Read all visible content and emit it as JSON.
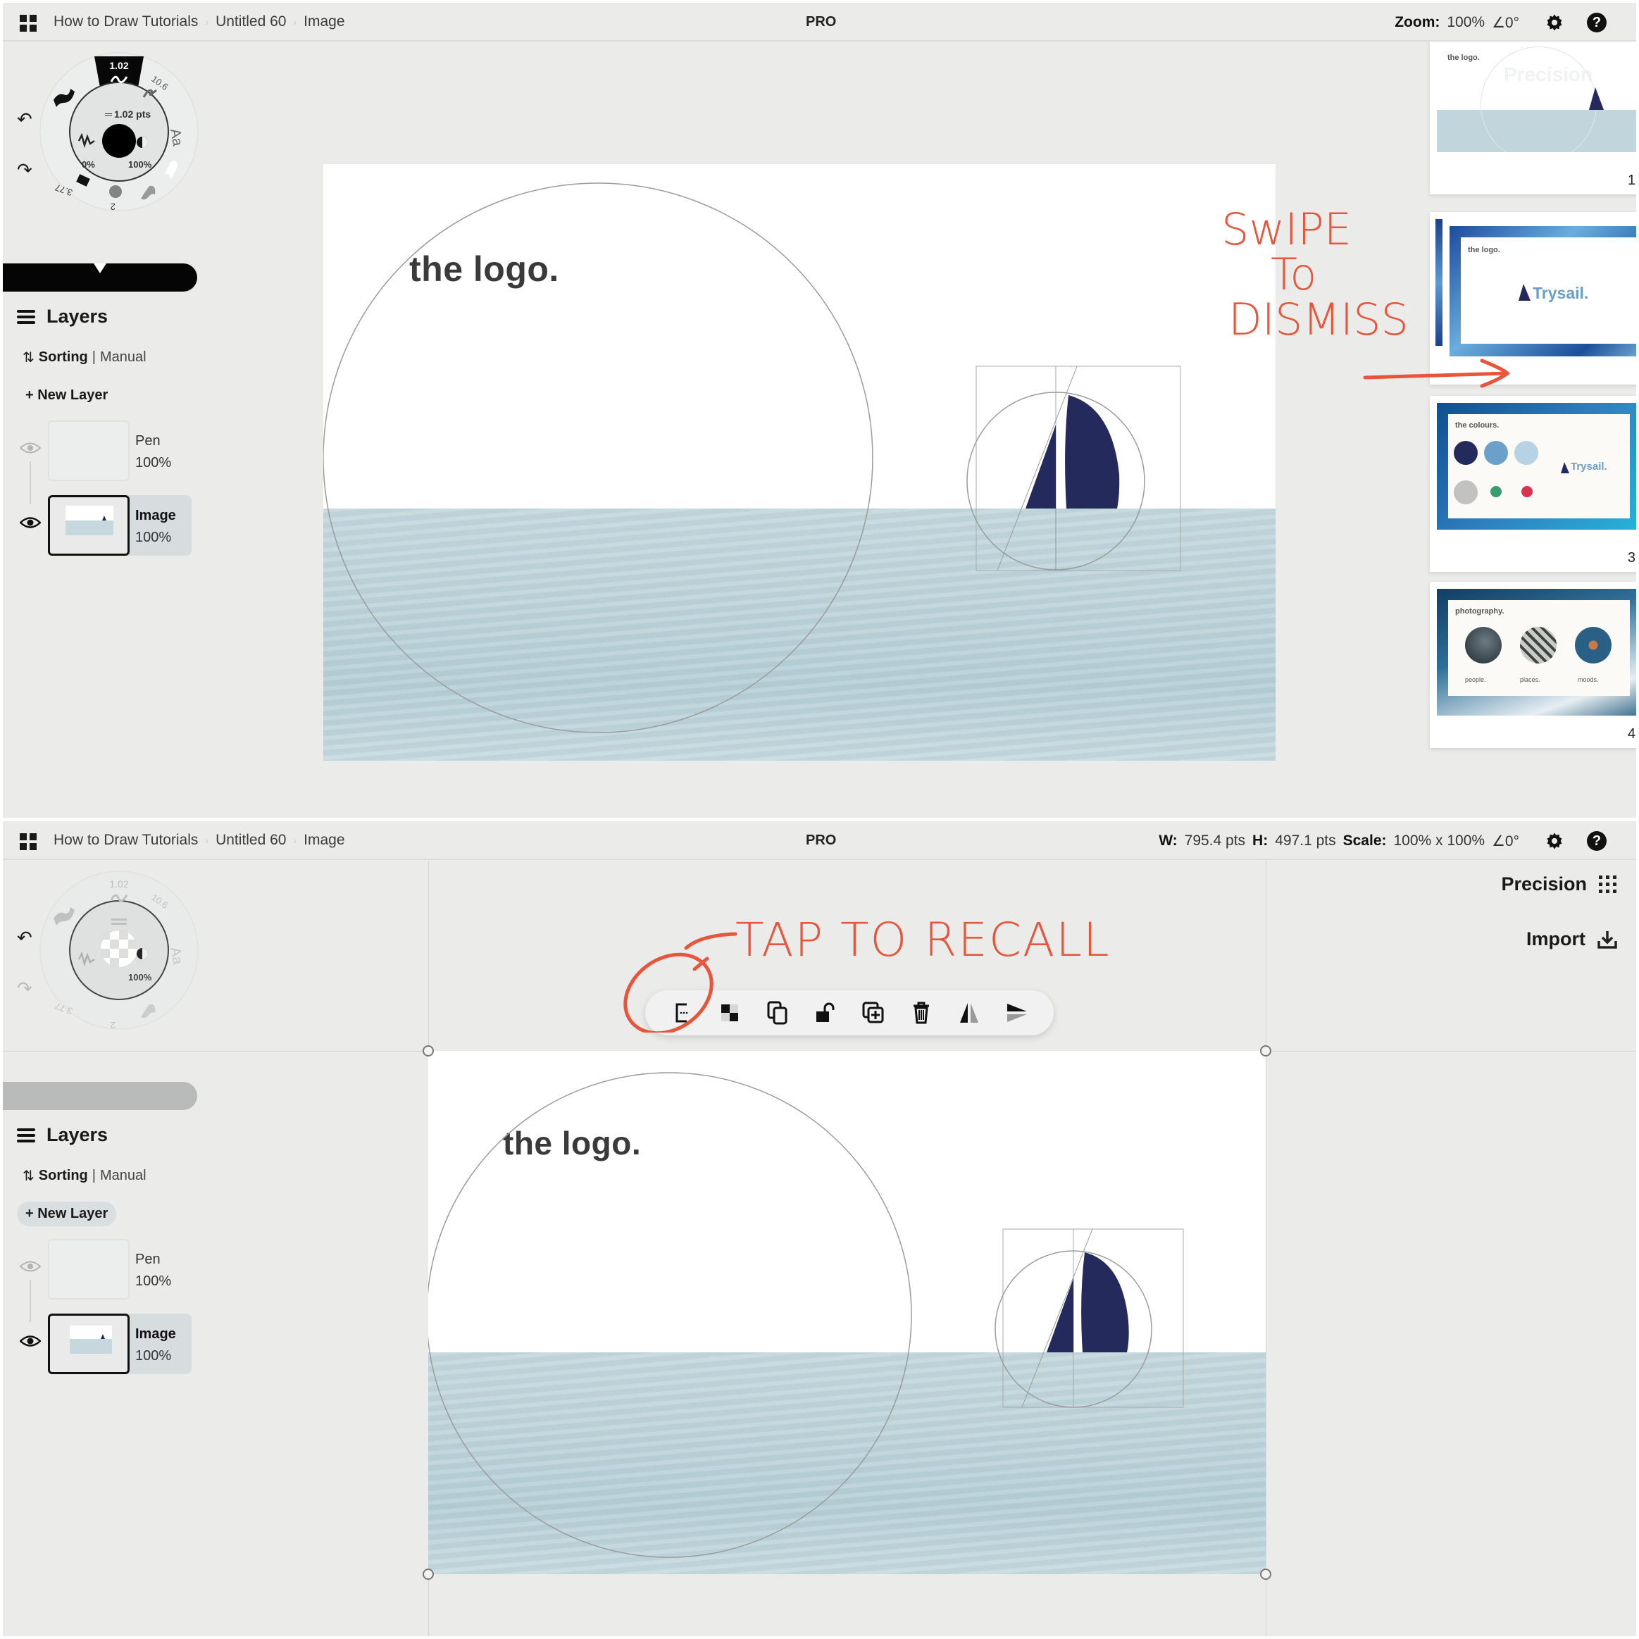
{
  "top_panel": {
    "header": {
      "breadcrumbs": [
        "How to Draw Tutorials",
        "Untitled 60",
        "Image"
      ],
      "badge": "PRO",
      "zoom_label": "Zoom:",
      "zoom_value": "100%",
      "angle": "∠0°"
    },
    "brush_wheel": {
      "selected_size": "1.02",
      "size_readout": "1.02 pts",
      "other_sizes": [
        "10.6",
        "3.77",
        "2"
      ],
      "text_tool": "Aa",
      "smoothing": "0%",
      "opacity": "100%",
      "color": "#000000"
    },
    "layers": {
      "title": "Layers",
      "sorting_label": "Sorting",
      "sorting_value": "Manual",
      "new_layer": "+ New Layer",
      "items": [
        {
          "name": "Pen",
          "opacity": "100%",
          "visible": true,
          "selected": false
        },
        {
          "name": "Image",
          "opacity": "100%",
          "visible": true,
          "selected": true
        }
      ]
    },
    "canvas": {
      "heading": "the logo.",
      "sail_color": "#242a5c"
    },
    "thumbnails": [
      {
        "page": "1",
        "heading": "the logo.",
        "ghost_text": "Precision"
      },
      {
        "page": "",
        "heading": "the logo.",
        "brand": "Trysail."
      },
      {
        "page": "3",
        "heading": "the colours.",
        "brand": "Trysail.",
        "swatches": [
          "#242a5c",
          "#6aa0c9",
          "#b6d3e6",
          "#c2c2c0",
          "#3a9d6e",
          "#d9334f"
        ]
      },
      {
        "page": "4",
        "heading": "photography.",
        "captions": [
          "people.",
          "places.",
          "moods."
        ]
      }
    ],
    "annotation": "Swipe To Dismiss",
    "annotation_lines": [
      "SwIPE",
      "To",
      "DISMISS"
    ]
  },
  "bottom_panel": {
    "header": {
      "breadcrumbs": [
        "How to Draw Tutorials",
        "Untitled 60",
        "Image"
      ],
      "badge": "PRO",
      "w_label": "W:",
      "w_value": "795.4 pts",
      "h_label": "H:",
      "h_value": "497.1 pts",
      "scale_label": "Scale:",
      "scale_value": "100% x 100%",
      "angle": "∠0°"
    },
    "brush_wheel": {
      "selected_size": "1.02",
      "other_sizes": [
        "10.6",
        "3.77",
        "2"
      ],
      "text_tool": "Aa",
      "opacity": "100%"
    },
    "layers": {
      "title": "Layers",
      "sorting_label": "Sorting",
      "sorting_value": "Manual",
      "new_layer": "+ New Layer",
      "items": [
        {
          "name": "Pen",
          "opacity": "100%",
          "visible": true,
          "selected": false
        },
        {
          "name": "Image",
          "opacity": "100%",
          "visible": true,
          "selected": true
        }
      ]
    },
    "right_tools": {
      "precision": "Precision",
      "import": "Import"
    },
    "toolbar": {
      "items": [
        "recall-icon",
        "checkerboard-icon",
        "duplicate-icon",
        "unlock-icon",
        "add-copy-icon",
        "trash-icon",
        "flip-horizontal-icon",
        "flip-vertical-icon"
      ]
    },
    "canvas": {
      "heading": "the logo.",
      "sail_color": "#242a5c"
    },
    "annotation": "Tap To Recall",
    "annotation_text": "TAP TO RECALL"
  },
  "colors": {
    "annotation": "#e8553b",
    "sail": "#242a5c",
    "panel_bg": "#ebecea"
  }
}
